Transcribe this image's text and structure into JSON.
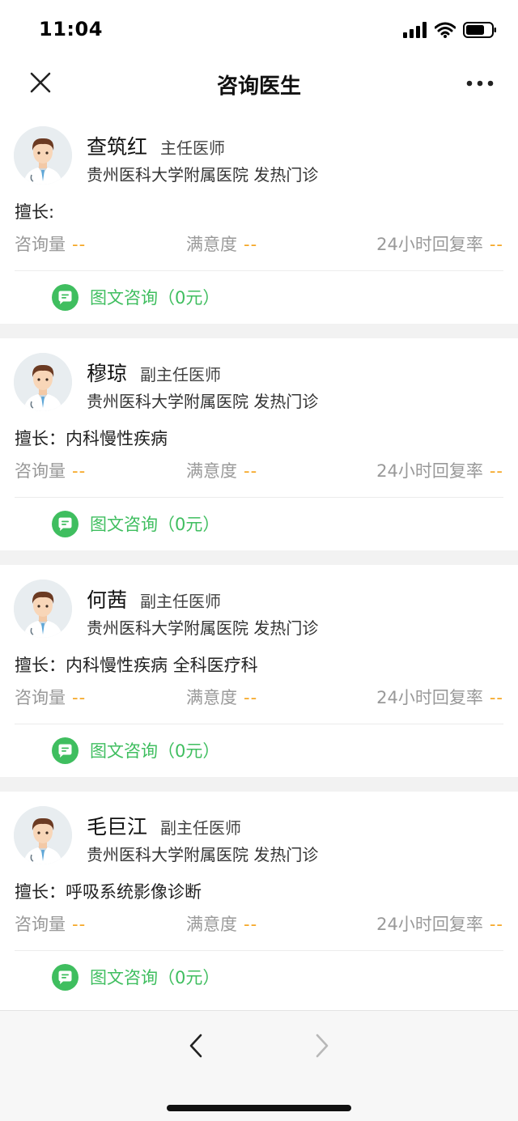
{
  "status_bar": {
    "time": "11:04"
  },
  "nav": {
    "title": "咨询医生",
    "close_icon": "close-icon",
    "more_icon": "more-icon"
  },
  "colors": {
    "accent_green": "#3fbe5f",
    "stat_value_orange": "#f5a623",
    "muted_gray": "#999999"
  },
  "doctors": [
    {
      "name": "查筑红",
      "title": "主任医师",
      "hospital": "贵州医科大学附属医院 发热门诊",
      "expertise": "擅长:",
      "stats": [
        {
          "label": "咨询量",
          "value": "--"
        },
        {
          "label": "满意度",
          "value": "--"
        },
        {
          "label": "24小时回复率",
          "value": "--"
        }
      ],
      "consult_label": "图文咨询（0元）"
    },
    {
      "name": "穆琼",
      "title": "副主任医师",
      "hospital": "贵州医科大学附属医院 发热门诊",
      "expertise": "擅长：内科慢性疾病",
      "stats": [
        {
          "label": "咨询量",
          "value": "--"
        },
        {
          "label": "满意度",
          "value": "--"
        },
        {
          "label": "24小时回复率",
          "value": "--"
        }
      ],
      "consult_label": "图文咨询（0元）"
    },
    {
      "name": "何茜",
      "title": "副主任医师",
      "hospital": "贵州医科大学附属医院 发热门诊",
      "expertise": "擅长：内科慢性疾病 全科医疗科",
      "stats": [
        {
          "label": "咨询量",
          "value": "--"
        },
        {
          "label": "满意度",
          "value": "--"
        },
        {
          "label": "24小时回复率",
          "value": "--"
        }
      ],
      "consult_label": "图文咨询（0元）"
    },
    {
      "name": "毛巨江",
      "title": "副主任医师",
      "hospital": "贵州医科大学附属医院 发热门诊",
      "expertise": "擅长：呼吸系统影像诊断",
      "stats": [
        {
          "label": "咨询量",
          "value": "--"
        },
        {
          "label": "满意度",
          "value": "--"
        },
        {
          "label": "24小时回复率",
          "value": "--"
        }
      ],
      "consult_label": "图文咨询（0元）"
    }
  ],
  "bottom_bar": {
    "back_icon": "chevron-left-icon",
    "forward_icon": "chevron-right-icon"
  }
}
